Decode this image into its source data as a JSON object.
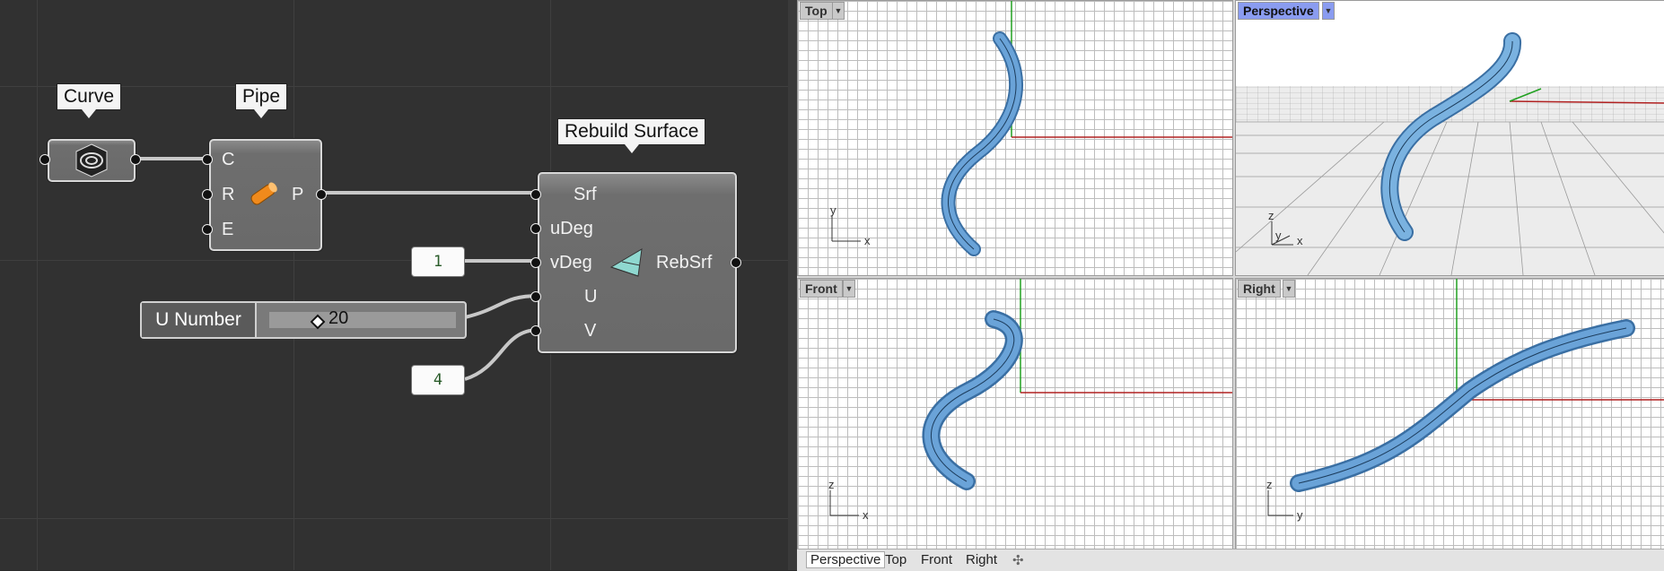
{
  "canvas": {
    "curve": {
      "label": "Curve"
    },
    "pipe": {
      "label": "Pipe",
      "inputs": [
        "C",
        "R",
        "E"
      ],
      "output": "P"
    },
    "rebuild": {
      "label": "Rebuild Surface",
      "inputs": [
        "Srf",
        "uDeg",
        "vDeg",
        "U",
        "V"
      ],
      "output": "RebSrf"
    },
    "panel_one": "1",
    "panel_four": "4",
    "slider": {
      "name": "U Number",
      "value": "20"
    }
  },
  "viewports": {
    "top": {
      "title": "Top",
      "axes": [
        "y",
        "x"
      ]
    },
    "perspective": {
      "title": "Perspective",
      "axes": [
        "z",
        "y",
        "x"
      ]
    },
    "front": {
      "title": "Front",
      "axes": [
        "z",
        "x"
      ]
    },
    "right": {
      "title": "Right",
      "axes": [
        "z",
        "y"
      ]
    }
  },
  "tabs": [
    "Perspective",
    "Top",
    "Front",
    "Right"
  ],
  "colors": {
    "pipe_fill": "#6aa3d8",
    "pipe_edge": "#3a6fa3",
    "x_axis": "#b02020",
    "y_axis": "#20a020",
    "active_viewport": "#8a9cf0"
  }
}
